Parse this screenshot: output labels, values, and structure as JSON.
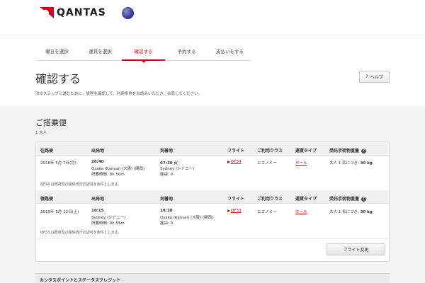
{
  "header": {
    "logo_text": "QANTAS",
    "logo_icon": "kangaroo-tail-icon",
    "alliance_icon": "oneworld-icon"
  },
  "steps": [
    {
      "label": "曜日を選択",
      "active": false
    },
    {
      "label": "運賃を選択",
      "active": false
    },
    {
      "label": "確認する",
      "active": true
    },
    {
      "label": "予約する",
      "active": false
    },
    {
      "label": "支払いをする",
      "active": false
    }
  ],
  "page": {
    "title": "確認する",
    "help_label": "ヘルプ",
    "help_icon": "question-icon",
    "intro": "次のステップに進むために、旅程を確認して、利用条件をお読みいただき、合意してください。"
  },
  "flights_section": {
    "title": "ご搭乗便",
    "passengers": "1 大人",
    "headers_outbound": [
      "往路便",
      "出発地",
      "到着地",
      "フライト",
      "ご利用クラス",
      "運賃タイプ",
      "受託手荷物重量"
    ],
    "headers_inbound": [
      "復路便",
      "出発地",
      "到着地",
      "フライト",
      "ご利用クラス",
      "運賃タイプ",
      "受託手荷物重量"
    ],
    "outbound": {
      "date": "2018年 5月 7日(月)",
      "dep_time": "20:40",
      "dep_place": "Osaka (Kansai) (大阪) (関西)",
      "duration": "所要時間: 9h 50m",
      "arr_time": "07:30 火",
      "arr_place": "Sydney (シドニー)",
      "stops": "経由: 0",
      "flight": "QF34",
      "cabin": "エコノミー",
      "fare": "セール",
      "baggage_label": "大人 1 名につき:",
      "baggage_value": "30 kg",
      "note": "QF34 は政府及び関係省庁の認可を条件とします。"
    },
    "inbound": {
      "date": "2018年 5月 12日(土)",
      "dep_time": "10:15",
      "dep_place": "Sydney (シドニー)",
      "duration": "所要時間: 9h 55m",
      "arr_time": "19:10",
      "arr_place": "Osaka (Kansai) (大阪) (関西)",
      "stops": "経由: 0",
      "flight": "QF33",
      "cabin": "エコノミー",
      "fare": "セール",
      "baggage_label": "大人 1 名につき:",
      "baggage_value": "30 kg",
      "note": "QF33 は政府及び関係省庁の認可を条件とします。"
    },
    "change_flight_label": "フライト変更"
  },
  "bottom_section": {
    "title": "カンタスポイントとステータスクレジット"
  },
  "colors": {
    "accent": "#d6001c",
    "panel_bg": "#f3f3f3"
  }
}
